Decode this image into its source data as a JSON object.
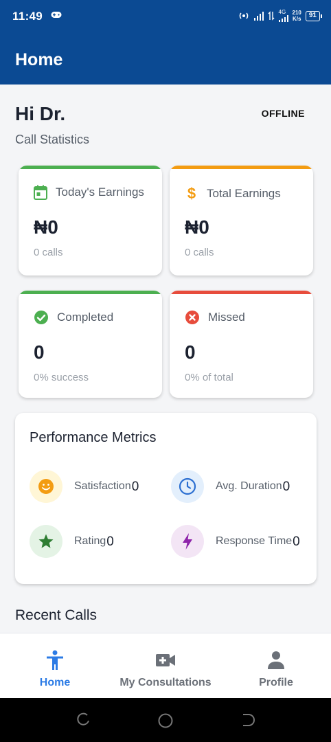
{
  "statusbar": {
    "time": "11:49",
    "net_4g": "4G",
    "speed_value": "210",
    "speed_unit": "K/s",
    "battery": "91"
  },
  "appbar": {
    "title": "Home"
  },
  "header": {
    "greeting": "Hi Dr.",
    "status": "OFFLINE",
    "subtitle": "Call Statistics"
  },
  "stats": {
    "today": {
      "label": "Today's Earnings",
      "value": "₦0",
      "sub": "0 calls",
      "accent": "#4caf50",
      "icon": "calendar-icon"
    },
    "total": {
      "label": "Total Earnings",
      "value": "₦0",
      "sub": "0 calls",
      "accent": "#f39c12",
      "icon": "dollar-icon"
    },
    "completed": {
      "label": "Completed",
      "value": "0",
      "sub": "0% success",
      "accent": "#4caf50",
      "icon": "check-circle-icon"
    },
    "missed": {
      "label": "Missed",
      "value": "0",
      "sub": "0% of total",
      "accent": "#e74c3c",
      "icon": "x-circle-icon"
    }
  },
  "performance": {
    "title": "Performance Metrics",
    "satisfaction": {
      "label": "Satisfaction",
      "value": "0",
      "icon": "smiley-icon"
    },
    "duration": {
      "label": "Avg. Duration",
      "value": "0",
      "icon": "clock-icon"
    },
    "rating": {
      "label": "Rating",
      "value": "0",
      "icon": "star-icon"
    },
    "response": {
      "label": "Response Time",
      "value": "0",
      "icon": "lightning-icon"
    }
  },
  "recent": {
    "title": "Recent Calls"
  },
  "nav": {
    "home": "Home",
    "consultations": "My Consultations",
    "profile": "Profile"
  },
  "colors": {
    "primary": "#0b4a93",
    "active_nav": "#2c7be5",
    "success": "#4caf50",
    "warning": "#f39c12",
    "danger": "#e74c3c"
  }
}
